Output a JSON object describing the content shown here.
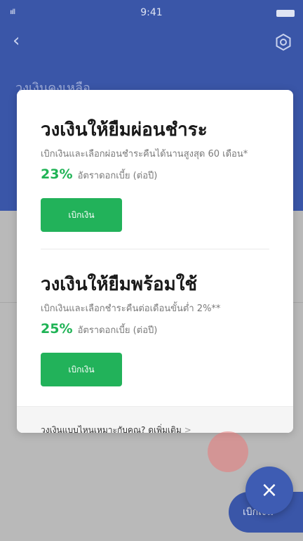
{
  "status": {
    "time": "9:41",
    "signal": "ııll"
  },
  "header": {
    "back_icon": "‹",
    "bg_title": "วงเงินคงเหลือ"
  },
  "offers": [
    {
      "title": "วงเงินให้ยืมผ่อนชำระ",
      "description": "เบิกเงินและเลือกผ่อนชำระคืนได้นานสูงสุด 60 เดือน*",
      "rate": "23%",
      "rate_label": "อัตราดอกเบี้ย (ต่อปี)",
      "button": "เบิกเงิน"
    },
    {
      "title": "วงเงินให้ยืมพร้อมใช้",
      "description": "เบิกเงินและเลือกชำระคืนต่อเดือนขั้นต่ำ 2%**",
      "rate": "25%",
      "rate_label": "อัตราดอกเบี้ย (ต่อปี)",
      "button": "เบิกเงิน"
    }
  ],
  "footer": {
    "link_text": "วงเงินแบบไหนเหมาะกับคุณ? ดูเพิ่มเติม",
    "chevron": ">",
    "dots": "......"
  },
  "fab": {
    "close_icon": "×"
  },
  "bg_withdraw": {
    "label": "เบิกเงิน"
  },
  "colors": {
    "primary": "#3a56a8",
    "accent_green": "#22b25a",
    "rate_green": "#1fb355"
  }
}
